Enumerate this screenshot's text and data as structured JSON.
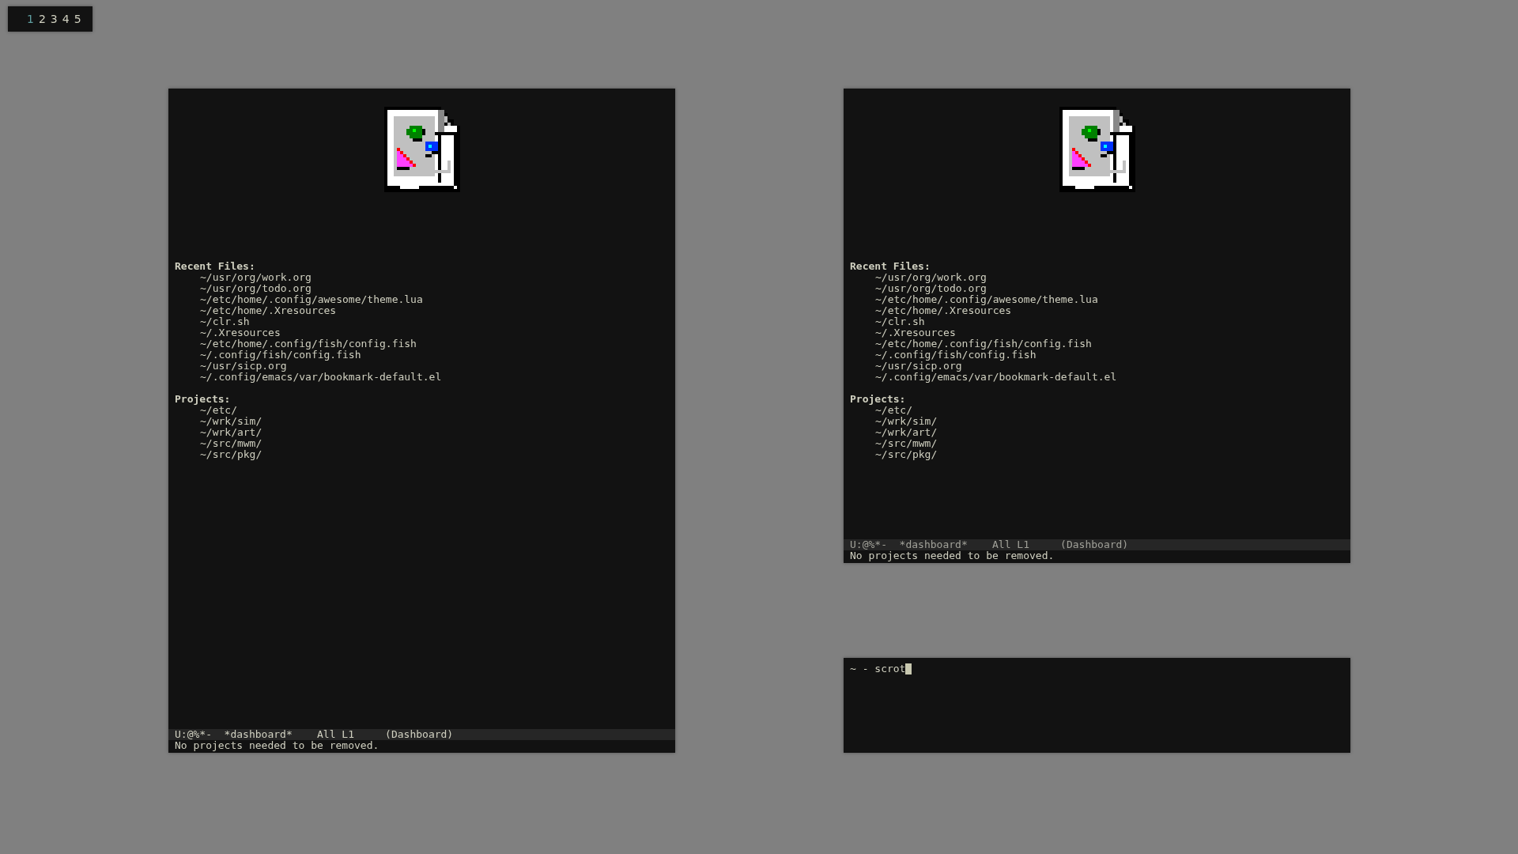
{
  "workspaces": [
    {
      "label": "1",
      "selected": true
    },
    {
      "label": "2",
      "selected": false
    },
    {
      "label": "3",
      "selected": false
    },
    {
      "label": "4",
      "selected": false
    },
    {
      "label": "5",
      "selected": false
    }
  ],
  "windows": [
    {
      "kind": "dashboard",
      "active": true,
      "sections": [
        {
          "heading": "Recent Files:",
          "items": [
            "~/usr/org/work.org",
            "~/usr/org/todo.org",
            "~/etc/home/.config/awesome/theme.lua",
            "~/etc/home/.Xresources",
            "~/clr.sh",
            "~/.Xresources",
            "~/etc/home/.config/fish/config.fish",
            "~/.config/fish/config.fish",
            "~/usr/sicp.org",
            "~/.config/emacs/var/bookmark-default.el"
          ]
        },
        {
          "heading": "Projects:",
          "items": [
            "~/etc/",
            "~/wrk/sim/",
            "~/wrk/art/",
            "~/src/mwm/",
            "~/src/pkg/"
          ]
        }
      ],
      "modeline": {
        "flags": "U:@%*-",
        "buffer": "*dashboard*",
        "position": "All L1",
        "mode": "(Dashboard)"
      },
      "echo": "No projects needed to be removed."
    },
    {
      "kind": "dashboard",
      "active": false,
      "sections": [
        {
          "heading": "Recent Files:",
          "items": [
            "~/usr/org/work.org",
            "~/usr/org/todo.org",
            "~/etc/home/.config/awesome/theme.lua",
            "~/etc/home/.Xresources",
            "~/clr.sh",
            "~/.Xresources",
            "~/etc/home/.config/fish/config.fish",
            "~/.config/fish/config.fish",
            "~/usr/sicp.org",
            "~/.config/emacs/var/bookmark-default.el"
          ]
        },
        {
          "heading": "Projects:",
          "items": [
            "~/etc/",
            "~/wrk/sim/",
            "~/wrk/art/",
            "~/src/mwm/",
            "~/src/pkg/"
          ]
        }
      ],
      "modeline": {
        "flags": "U:@%*-",
        "buffer": "*dashboard*",
        "position": "All L1",
        "mode": "(Dashboard)"
      },
      "echo": "No projects needed to be removed."
    },
    {
      "kind": "terminal",
      "prompt": "~ - scrot"
    }
  ]
}
